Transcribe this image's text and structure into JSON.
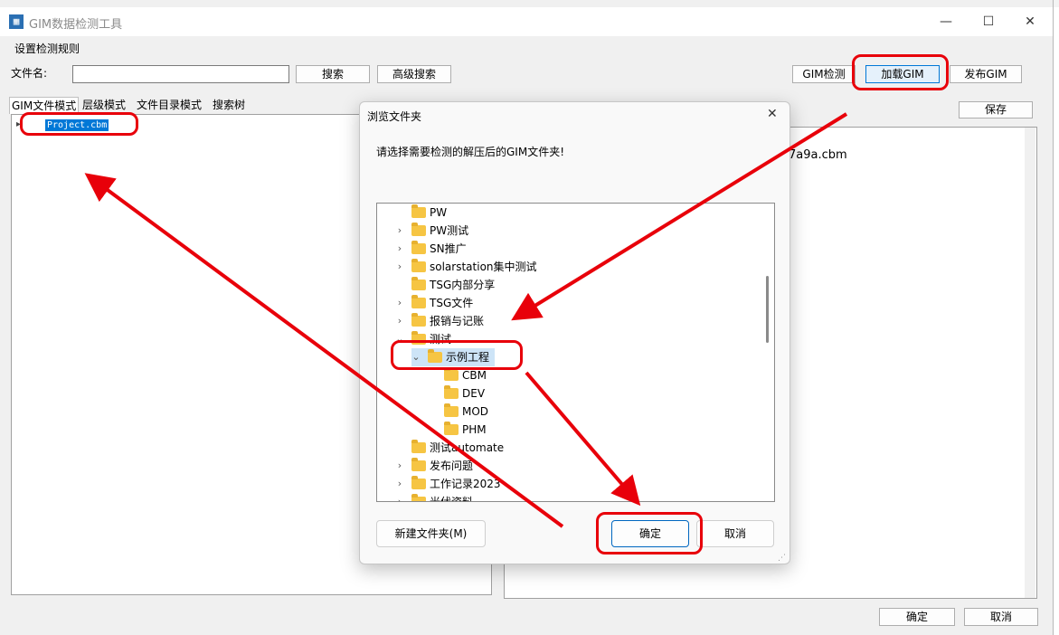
{
  "app": {
    "title": "GIM数据检测工具",
    "menu_label": "设置检测规则",
    "window_controls": [
      "—",
      "☐",
      "✕"
    ]
  },
  "toolbar": {
    "filename_label": "文件名:",
    "filename_value": "",
    "search": "搜索",
    "advanced_search": "高级搜索",
    "gim_check": "GIM检测",
    "load_gim": "加载GIM",
    "publish_gim": "发布GIM",
    "save": "保存"
  },
  "tabs": [
    "GIM文件模式",
    "层级模式",
    "文件目录模式",
    "搜索树"
  ],
  "left_tree": {
    "root_label": "Project.cbm"
  },
  "right_panel": {
    "partial_text": "7a9a.cbm"
  },
  "footer": {
    "ok": "确定",
    "cancel": "取消"
  },
  "dialog": {
    "title": "浏览文件夹",
    "close_glyph": "✕",
    "prompt": "请选择需要检测的解压后的GIM文件夹!",
    "tree_items": [
      {
        "label": "PW",
        "expander": ""
      },
      {
        "label": "PW测试",
        "expander": "›"
      },
      {
        "label": "SN推广",
        "expander": "›"
      },
      {
        "label": "solarstation集中测试",
        "expander": "›"
      },
      {
        "label": "TSG内部分享",
        "expander": ""
      },
      {
        "label": "TSG文件",
        "expander": "›"
      },
      {
        "label": "报销与记账",
        "expander": "›"
      },
      {
        "label": "测试",
        "expander": "⌄"
      },
      {
        "label": "示例工程",
        "expander": "⌄"
      },
      {
        "label": "CBM",
        "expander": ""
      },
      {
        "label": "DEV",
        "expander": ""
      },
      {
        "label": "MOD",
        "expander": ""
      },
      {
        "label": "PHM",
        "expander": ""
      },
      {
        "label": "测试automate",
        "expander": ""
      },
      {
        "label": "发布问题",
        "expander": "›"
      },
      {
        "label": "工作记录2023",
        "expander": "›"
      },
      {
        "label": "光伏资料",
        "expander": "›"
      }
    ],
    "new_folder": "新建文件夹(M)",
    "ok": "确定",
    "cancel": "取消"
  },
  "colors": {
    "annotation_red": "#e8000a",
    "selection_blue": "#cde4f7",
    "folder_yellow": "#f6c543"
  }
}
